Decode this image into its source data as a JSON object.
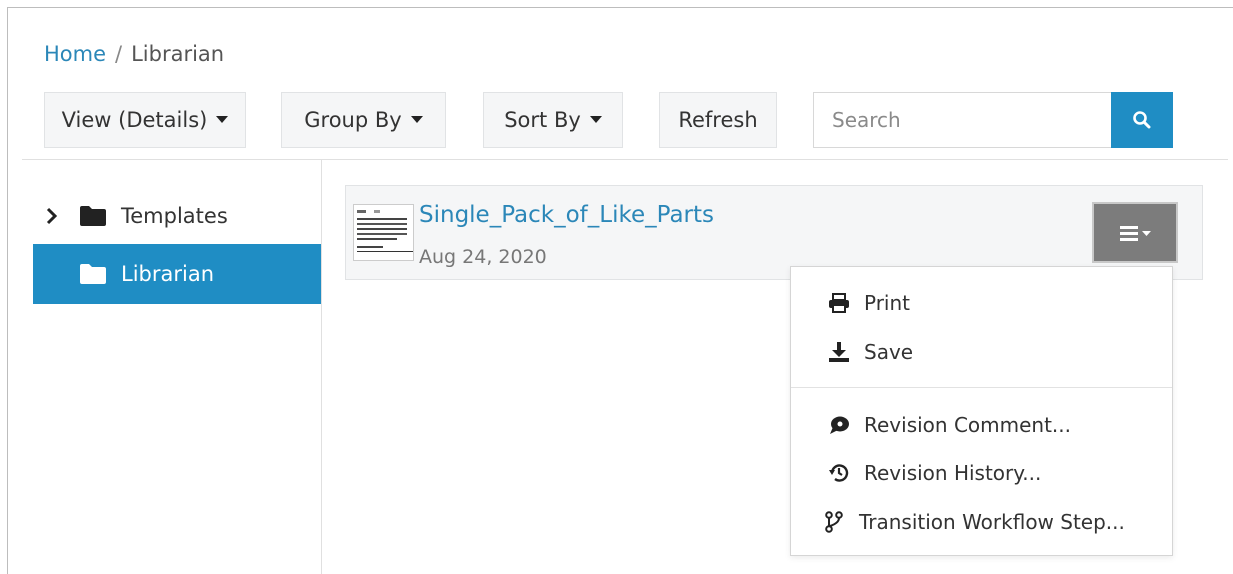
{
  "breadcrumb": {
    "home": "Home",
    "separator": "/",
    "current": "Librarian"
  },
  "toolbar": {
    "view_label": "View (Details)",
    "group_label": "Group By",
    "sort_label": "Sort By",
    "refresh_label": "Refresh",
    "search_placeholder": "Search",
    "search_value": ""
  },
  "tree": {
    "items": [
      {
        "label": "Templates",
        "icon": "folder-icon",
        "expander": "chevron-right-icon",
        "selected": false
      },
      {
        "label": "Librarian",
        "icon": "folder-icon",
        "selected": true
      }
    ]
  },
  "document": {
    "title": "Single_Pack_of_Like_Parts",
    "date": "Aug 24, 2020",
    "menu_icon": "bars-icon"
  },
  "menu": {
    "items": [
      {
        "label": "Print",
        "icon": "print-icon"
      },
      {
        "label": "Save",
        "icon": "download-icon"
      },
      {
        "label": "Revision Comment...",
        "icon": "comment-icon"
      },
      {
        "label": "Revision History...",
        "icon": "history-icon"
      },
      {
        "label": "Transition Workflow Step...",
        "icon": "branch-icon"
      }
    ]
  },
  "colors": {
    "accent": "#1f8dc4",
    "link": "#2b87b8",
    "menu_button": "#7c7c7c"
  }
}
